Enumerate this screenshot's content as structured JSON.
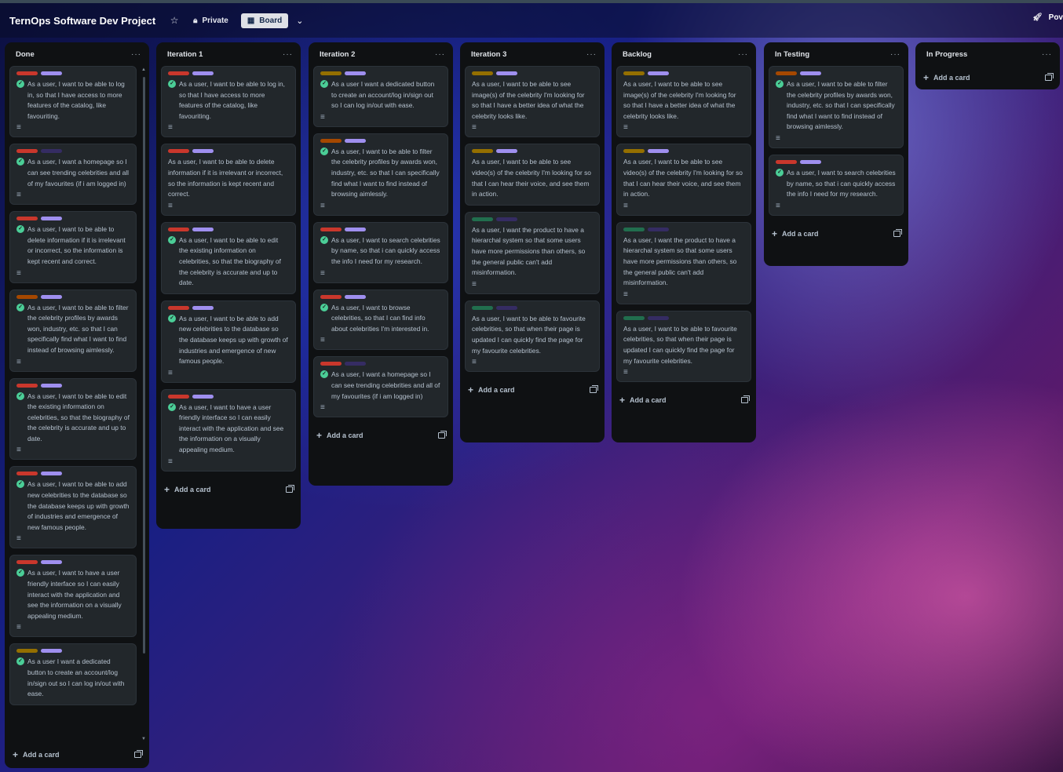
{
  "board": {
    "title": "TernOps Software Dev Project",
    "visibility": "Private",
    "view": "Board",
    "right_label": "Pov"
  },
  "colors": {
    "red": "#c9372c",
    "purple": "#9f8fef",
    "darkpurple": "#352c63",
    "orange": "#a54800",
    "yellow": "#946f00",
    "green": "#4bce97",
    "darkgreen": "#216e4e"
  },
  "add_card_label": "Add a card",
  "lists": [
    {
      "title": "Done",
      "cards": [
        {
          "labels": [
            "red",
            "purple"
          ],
          "done": true,
          "text": "As a user, I want to be able to log in, so that I have access to more features of the catalog, like favouriting.",
          "desc": true
        },
        {
          "labels": [
            "red",
            "darkpurple"
          ],
          "done": true,
          "text": "As a user, I want a homepage so I can see trending celebrities and all of my favourites (if i am logged in)",
          "desc": true
        },
        {
          "labels": [
            "red",
            "purple"
          ],
          "done": true,
          "text": "As a user, I want to be able to delete information if it is irrelevant or incorrect, so the information is kept recent and correct.",
          "desc": true
        },
        {
          "labels": [
            "orange",
            "purple"
          ],
          "done": true,
          "text": "As a user, I want to be able to filter the celebrity profiles by awards won, industry, etc. so that I can specifically find what I want to find instead of browsing aimlessly.",
          "desc": true
        },
        {
          "labels": [
            "red",
            "purple"
          ],
          "done": true,
          "text": "As a user, I want to be able to edit the existing information on celebrities, so that the biography of the celebrity is accurate and up to date.",
          "desc": true
        },
        {
          "labels": [
            "red",
            "purple"
          ],
          "done": true,
          "text": "As a user, I want to be able to add new celebrities to the database so the database keeps up with growth of industries and emergence of new famous people.",
          "desc": true
        },
        {
          "labels": [
            "red",
            "purple"
          ],
          "done": true,
          "text": "As a user, I want to have a user friendly interface so I can easily interact with the application and see the information on a visually appealing medium.",
          "desc": true
        },
        {
          "labels": [
            "yellow",
            "purple"
          ],
          "done": true,
          "text": "As a user I want a dedicated button to create an account/log in/sign out so I can log in/out with ease.",
          "desc": false
        }
      ]
    },
    {
      "title": "Iteration 1",
      "cards": [
        {
          "labels": [
            "red",
            "purple"
          ],
          "done": true,
          "text": "As a user, I want to be able to log in, so that I have access to more features of the catalog, like favouriting.",
          "desc": true
        },
        {
          "labels": [
            "red",
            "purple"
          ],
          "done": false,
          "text": "As a user, I want to be able to delete information if it is irrelevant or incorrect, so the information is kept recent and correct.",
          "desc": true
        },
        {
          "labels": [
            "red",
            "purple"
          ],
          "done": true,
          "text": "As a user, I want to be able to edit the existing information on celebrities, so that the biography of the celebrity is accurate and up to date.",
          "desc": false
        },
        {
          "labels": [
            "red",
            "purple"
          ],
          "done": true,
          "text": "As a user, I want to be able to add new celebrities to the database so the database keeps up with growth of industries and emergence of new famous people.",
          "desc": true
        },
        {
          "labels": [
            "red",
            "purple"
          ],
          "done": true,
          "text": "As a user, I want to have a user friendly interface so I can easily interact with the application and see the information on a visually appealing medium.",
          "desc": true
        }
      ]
    },
    {
      "title": "Iteration 2",
      "cards": [
        {
          "labels": [
            "yellow",
            "purple"
          ],
          "done": true,
          "text": "As a user I want a dedicated button to create an account/log in/sign out so I can log in/out with ease.",
          "desc": true
        },
        {
          "labels": [
            "orange",
            "purple"
          ],
          "done": true,
          "text": "As a user, I want to be able to filter the celebrity profiles by awards won, industry, etc. so that I can specifically find what I want to find instead of browsing aimlessly.",
          "desc": true
        },
        {
          "labels": [
            "red",
            "purple"
          ],
          "done": true,
          "text": "As a user, I want to search celebrities by name, so that i can quickly access the info I need for my research.",
          "desc": true
        },
        {
          "labels": [
            "red",
            "purple"
          ],
          "done": true,
          "text": "As a user, I want to browse celebrities, so that I can find info about celebrities I'm interested in.",
          "desc": true
        },
        {
          "labels": [
            "red",
            "darkpurple"
          ],
          "done": true,
          "text": "As a user, I want a homepage so I can see trending celebrities and all of my favourites (if i am logged in)",
          "desc": true
        }
      ]
    },
    {
      "title": "Iteration 3",
      "cards": [
        {
          "labels": [
            "yellow",
            "purple"
          ],
          "done": false,
          "text": "As a user, I want to be able to see image(s) of the celebrity I'm looking for so that I have a better idea of what the celebrity looks like.",
          "desc": true
        },
        {
          "labels": [
            "yellow",
            "purple"
          ],
          "done": false,
          "text": "As a user, I want to be able to see video(s) of the celebrity I'm looking for so that I can hear their voice, and see them in action.",
          "desc": false
        },
        {
          "labels": [
            "darkgreen",
            "darkpurple"
          ],
          "done": false,
          "text": "As a user, I want the product to have a hierarchal system so that some users have more permissions than others, so the general public can't add misinformation.",
          "desc": true
        },
        {
          "labels": [
            "darkgreen",
            "darkpurple"
          ],
          "done": false,
          "text": "As a user, I want to be able to favourite celebrities, so that when their page is updated I can quickly find the page for my favourite celebrities.",
          "desc": true
        }
      ]
    },
    {
      "title": "Backlog",
      "cards": [
        {
          "labels": [
            "yellow",
            "purple"
          ],
          "done": false,
          "text": "As a user, I want to be able to see image(s) of the celebrity I'm looking for so that I have a better idea of what the celebrity looks like.",
          "desc": true
        },
        {
          "labels": [
            "yellow",
            "purple"
          ],
          "done": false,
          "text": "As a user, I want to be able to see video(s) of the celebrity I'm looking for so that I can hear their voice, and see them in action.",
          "desc": true
        },
        {
          "labels": [
            "darkgreen",
            "darkpurple"
          ],
          "done": false,
          "text": "As a user, I want the product to have a hierarchal system so that some users have more permissions than others, so the general public can't add misinformation.",
          "desc": true
        },
        {
          "labels": [
            "darkgreen",
            "darkpurple"
          ],
          "done": false,
          "text": "As a user, I want to be able to favourite celebrities, so that when their page is updated I can quickly find the page for my favourite celebrities.",
          "desc": true
        }
      ]
    },
    {
      "title": "In Testing",
      "cards": [
        {
          "labels": [
            "orange",
            "purple"
          ],
          "done": true,
          "text": "As a user, I want to be able to filter the celebrity profiles by awards won, industry, etc. so that I can specifically find what I want to find instead of browsing aimlessly.",
          "desc": true
        },
        {
          "labels": [
            "red",
            "purple"
          ],
          "done": true,
          "text": "As a user, I want to search celebrities by name, so that i can quickly access the info I need for my research.",
          "desc": true
        }
      ]
    },
    {
      "title": "In Progress",
      "cards": []
    }
  ]
}
